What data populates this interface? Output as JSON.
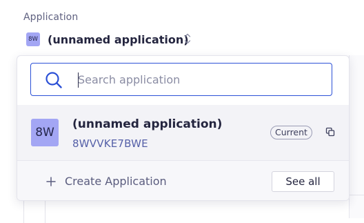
{
  "field": {
    "label": "Application"
  },
  "selector": {
    "badge": "8W",
    "name": "(unnamed application)"
  },
  "search": {
    "placeholder": "Search application",
    "value": ""
  },
  "applications": [
    {
      "badge": "8W",
      "name": "(unnamed application)",
      "id": "8WVVKE7BWE",
      "status": "Current"
    }
  ],
  "footer": {
    "create_label": "Create Application",
    "see_all_label": "See all"
  },
  "icons": {
    "search": "search-icon",
    "chevrons": "chevron-up-down-icon",
    "copy": "copy-icon",
    "plus": "plus-icon"
  },
  "colors": {
    "accent": "#2b50d6",
    "badge_bg": "#a3a6f4",
    "app_id_text": "#5560a8",
    "selected_row_bg": "#f3f3f7"
  }
}
